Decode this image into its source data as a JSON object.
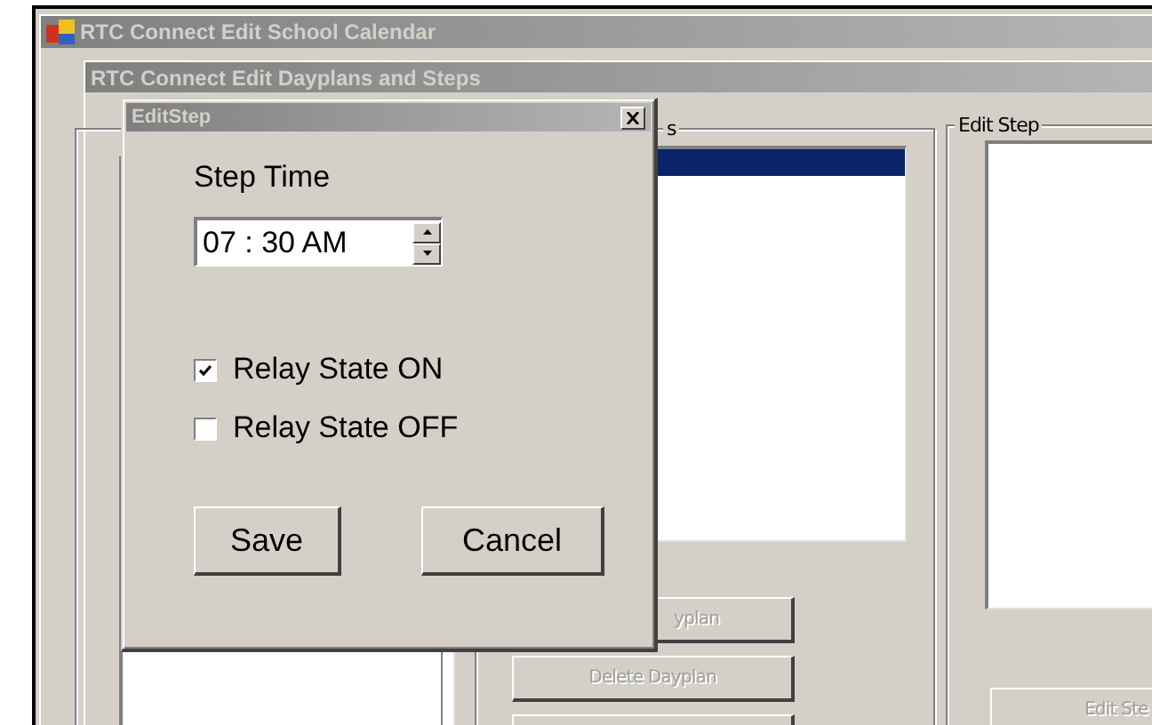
{
  "main_window": {
    "title": "RTC Connect Edit School Calendar"
  },
  "dayplans_window": {
    "title": "RTC Connect Edit Dayplans and Steps",
    "dayplan_buttons": [
      {
        "label": "yplan",
        "disabled": true
      },
      {
        "label": "Delete Dayplan",
        "disabled": true
      }
    ],
    "steps_group": {
      "legend": "s",
      "rows": [
        {
          "selected": true
        }
      ]
    },
    "edit_step_group": {
      "legend": "Edit Step",
      "button": {
        "label": "Edit Ste",
        "disabled": true
      }
    }
  },
  "dialog": {
    "title": "EditStep",
    "step_time_label": "Step Time",
    "time_value": "07 : 30 AM",
    "checkboxes": [
      {
        "label": "Relay State ON",
        "checked": true
      },
      {
        "label": "Relay State OFF",
        "checked": false
      }
    ],
    "buttons": [
      "Save",
      "Cancel"
    ]
  }
}
